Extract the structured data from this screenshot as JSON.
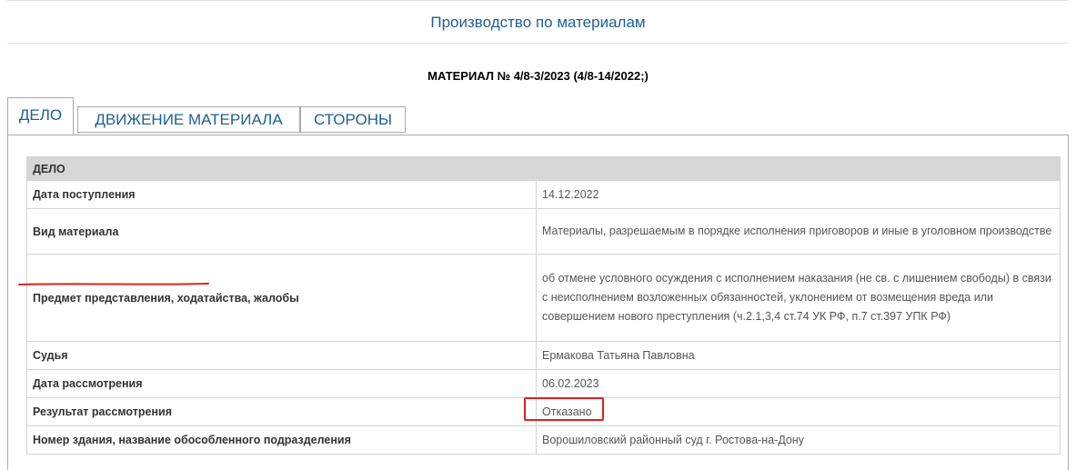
{
  "page_title": "Производство по материалам",
  "material_heading": "МАТЕРИАЛ № 4/8-3/2023 (4/8-14/2022;)",
  "tabs": [
    {
      "label": "ДЕЛО",
      "active": true
    },
    {
      "label": "ДВИЖЕНИЕ МАТЕРИАЛА",
      "active": false
    },
    {
      "label": "СТОРОНЫ",
      "active": false
    }
  ],
  "table": {
    "header": "ДЕЛО",
    "rows": [
      {
        "label": "Дата поступления",
        "value": "14.12.2022"
      },
      {
        "label": "Вид материала",
        "value": "Материалы, разрешаемым в порядке исполнения приговоров и иные в уголовном производстве"
      },
      {
        "label": "Предмет представления, ходатайства, жалобы",
        "value": "об отмене условного осуждения с исполнением наказания (не св. с лишением свободы) в связи с неисполнением возложенных обязанностей, уклонением от возмещения вреда или совершением нового преступления (ч.2.1,3,4 ст.74 УК РФ, п.7 ст.397 УПК РФ)"
      },
      {
        "label": "Судья",
        "value": "Ермакова Татьяна Павловна"
      },
      {
        "label": "Дата рассмотрения",
        "value": "06.02.2023"
      },
      {
        "label": "Результат рассмотрения",
        "value": "Отказано"
      },
      {
        "label": "Номер здания, название обособленного подразделения",
        "value": "Ворошиловский районный суд г. Ростова-на-Дону"
      }
    ]
  },
  "colors": {
    "link_blue": "#1d5f95",
    "annotation_red": "#e0201e",
    "header_gray": "#d7d7d7"
  }
}
